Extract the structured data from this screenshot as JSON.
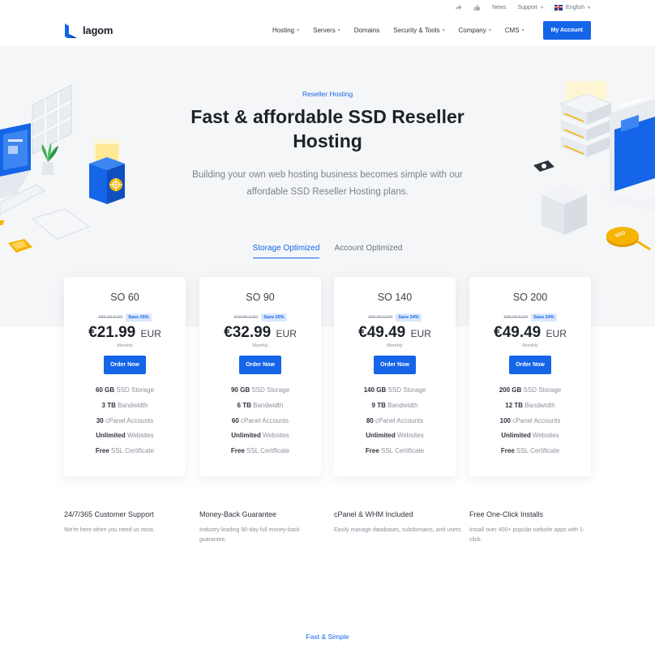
{
  "topbar": {
    "share_icon": "share-icon",
    "like_icon": "thumbs-up-icon",
    "news": "News",
    "support": "Support",
    "language": "English",
    "language_flag": "uk-flag-icon"
  },
  "header": {
    "logo_text": "lagom",
    "nav": {
      "hosting": "Hosting",
      "servers": "Servers",
      "domains": "Domains",
      "security": "Security & Tools",
      "company": "Company",
      "cms": "CMS"
    },
    "account_button": "My Account"
  },
  "hero": {
    "eyebrow": "Reseller Hosting",
    "title": "Fast & affordable SSD Reseller Hosting",
    "subtitle": "Building your own web hosting business becomes simple with our affordable SSD Reseller Hosting plans."
  },
  "tabs": {
    "storage": "Storage Optimized",
    "account": "Account Optimized"
  },
  "plans": [
    {
      "name": "SO 60",
      "old_price": "€29.33 EUR",
      "save": "Save 25%",
      "price": "€21.99",
      "currency": "EUR",
      "period": "Monthly",
      "order": "Order Now",
      "f1v": "60 GB",
      "f1l": "SSD Storage",
      "f2v": "3 TB",
      "f2l": "Bandwidth",
      "f3v": "30",
      "f3l": "cPanel Accounts",
      "f4v": "Unlimited",
      "f4l": "Websites",
      "f5v": "Free",
      "f5l": "SSL Certificate"
    },
    {
      "name": "SO 90",
      "old_price": "€43.99 EUR",
      "save": "Save 25%",
      "price": "€32.99",
      "currency": "EUR",
      "period": "Monthly",
      "order": "Order Now",
      "f1v": "90 GB",
      "f1l": "SSD Storage",
      "f2v": "6 TB",
      "f2l": "Bandwidth",
      "f3v": "60",
      "f3l": "cPanel Accounts",
      "f4v": "Unlimited",
      "f4l": "Websites",
      "f5v": "Free",
      "f5l": "SSL Certificate"
    },
    {
      "name": "SO 140",
      "old_price": "€65.00 EUR",
      "save": "Save 24%",
      "price": "€49.49",
      "currency": "EUR",
      "period": "Monthly",
      "order": "Order Now",
      "f1v": "140 GB",
      "f1l": "SSD Storage",
      "f2v": "9 TB",
      "f2l": "Bandwidth",
      "f3v": "80",
      "f3l": "cPanel Accounts",
      "f4v": "Unlimited",
      "f4l": "Websites",
      "f5v": "Free",
      "f5l": "SSL Certificate"
    },
    {
      "name": "SO 200",
      "old_price": "€65.00 EUR",
      "save": "Save 24%",
      "price": "€49.49",
      "currency": "EUR",
      "period": "Monthly",
      "order": "Order Now",
      "f1v": "200 GB",
      "f1l": "SSD Storage",
      "f2v": "12 TB",
      "f2l": "Bandwidth",
      "f3v": "100",
      "f3l": "cPanel Accounts",
      "f4v": "Unlimited",
      "f4l": "Websites",
      "f5v": "Free",
      "f5l": "SSL Certificate"
    }
  ],
  "features": [
    {
      "title": "24/7/365 Customer Support",
      "desc": "We're here when you need us most."
    },
    {
      "title": "Money-Back Guarantee",
      "desc": "Industry leading 90-day full money-back guarantee."
    },
    {
      "title": "cPanel & WHM Included",
      "desc": "Easily manage databases, subdomains, and users."
    },
    {
      "title": "Free One-Click Installs",
      "desc": "Install over 400+ popular website apps with 1-click."
    }
  ],
  "bottom": {
    "eyebrow": "Fast & Simple",
    "seo_badge": "SEO"
  },
  "colors": {
    "accent": "#1565e8",
    "hero_bg": "#f5f6f8",
    "gold": "#f5b400"
  }
}
